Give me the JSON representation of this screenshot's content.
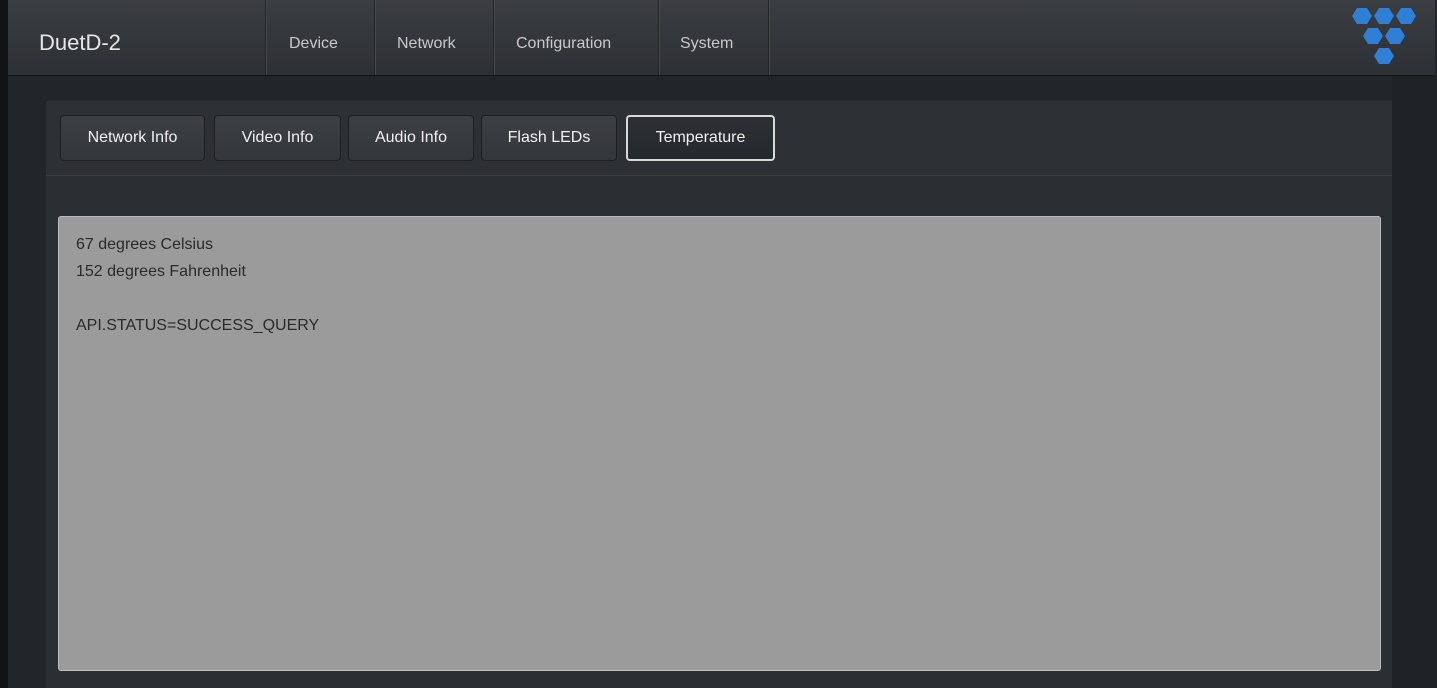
{
  "navbar": {
    "brand": "DuetD-2",
    "items": [
      {
        "label": "Device"
      },
      {
        "label": "Network"
      },
      {
        "label": "Configuration"
      },
      {
        "label": "System"
      }
    ],
    "logo_icon": "hexagon-cluster-logo",
    "logo_color": "#2f7fd6"
  },
  "tabs": [
    {
      "label": "Network Info",
      "active": false
    },
    {
      "label": "Video Info",
      "active": false
    },
    {
      "label": "Audio Info",
      "active": false
    },
    {
      "label": "Flash LEDs",
      "active": false
    },
    {
      "label": "Temperature",
      "active": true
    }
  ],
  "output": {
    "lines": [
      "67 degrees Celsius",
      "152 degrees Fahrenheit",
      "",
      "API.STATUS=SUCCESS_QUERY"
    ]
  }
}
